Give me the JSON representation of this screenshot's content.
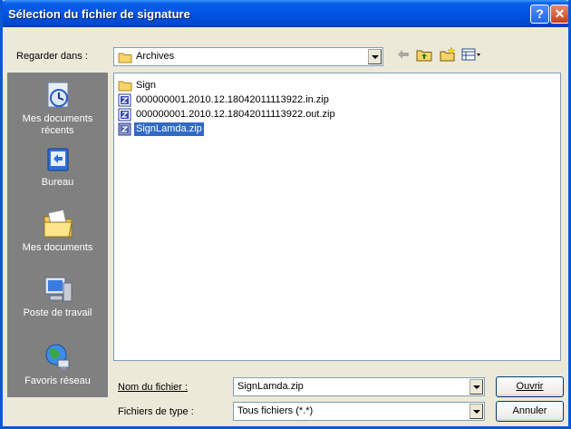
{
  "window": {
    "title": "Sélection du fichier de signature",
    "help_label": "?",
    "close_label": "✕"
  },
  "lookin": {
    "label": "Regarder dans :",
    "value": "Archives",
    "icon": "folder-icon"
  },
  "toolbar": {
    "back_icon": "back-arrow-icon",
    "up_icon": "folder-up-icon",
    "new_folder_icon": "new-folder-icon",
    "views_icon": "view-menu-icon"
  },
  "places": [
    {
      "label": "Mes documents récents",
      "icon": "recent-documents-icon"
    },
    {
      "label": "Bureau",
      "icon": "desktop-icon"
    },
    {
      "label": "Mes documents",
      "icon": "my-documents-icon"
    },
    {
      "label": "Poste de travail",
      "icon": "my-computer-icon"
    },
    {
      "label": "Favoris réseau",
      "icon": "network-places-icon"
    }
  ],
  "files": [
    {
      "name": "Sign",
      "type": "folder"
    },
    {
      "name": "000000001.2010.12.18042011113922.in.zip",
      "type": "zip"
    },
    {
      "name": "000000001.2010.12.18042011113922.out.zip",
      "type": "zip"
    },
    {
      "name": "SignLamda.zip",
      "type": "zip",
      "selected": true
    }
  ],
  "filename": {
    "label": "Nom du fichier :",
    "value": "SignLamda.zip"
  },
  "filetype": {
    "label": "Fichiers de type :",
    "value": "Tous fichiers (*.*)"
  },
  "buttons": {
    "open": "Ouvrir",
    "cancel": "Annuler"
  },
  "colors": {
    "titlebar": "#0054e3",
    "selection": "#316ac5",
    "face": "#ece9d8",
    "places_bar": "#808080"
  }
}
